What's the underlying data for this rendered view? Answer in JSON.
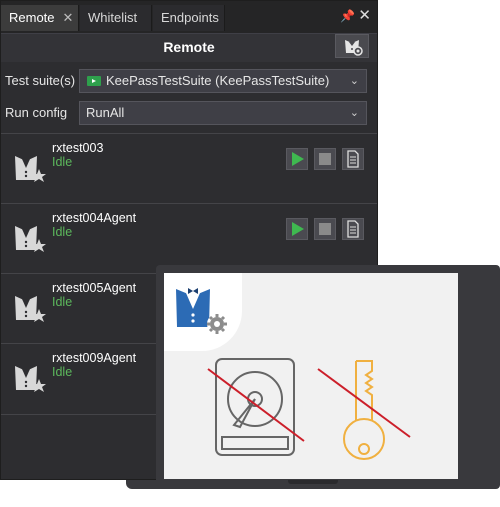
{
  "tabs": [
    {
      "label": "Remote",
      "active": true
    },
    {
      "label": "Whitelist",
      "active": false
    },
    {
      "label": "Endpoints",
      "active": false
    }
  ],
  "panel": {
    "title": "Remote"
  },
  "form": {
    "test_suite_label": "Test suite(s)",
    "test_suite_value": "KeePassTestSuite (KeePassTestSuite)",
    "run_config_label": "Run config",
    "run_config_value": "RunAll"
  },
  "agents": [
    {
      "name": "rxtest003",
      "status": "Idle",
      "show_controls": true
    },
    {
      "name": "rxtest004Agent",
      "status": "Idle",
      "show_controls": true
    },
    {
      "name": "rxtest005Agent",
      "status": "Idle",
      "show_controls": false
    },
    {
      "name": "rxtest009Agent",
      "status": "Idle",
      "show_controls": false
    }
  ],
  "colors": {
    "panel_bg": "#2d2d30",
    "status_green": "#5cb85c",
    "accent_blue": "#2c6bb5",
    "key_orange": "#f0b040",
    "strike_red": "#cc1f2a"
  },
  "icons": {
    "agent": "butler-with-star-icon",
    "play": "play-icon",
    "stop": "stop-icon",
    "report": "report-icon",
    "hdd": "hard-drive-icon",
    "key": "key-icon"
  }
}
